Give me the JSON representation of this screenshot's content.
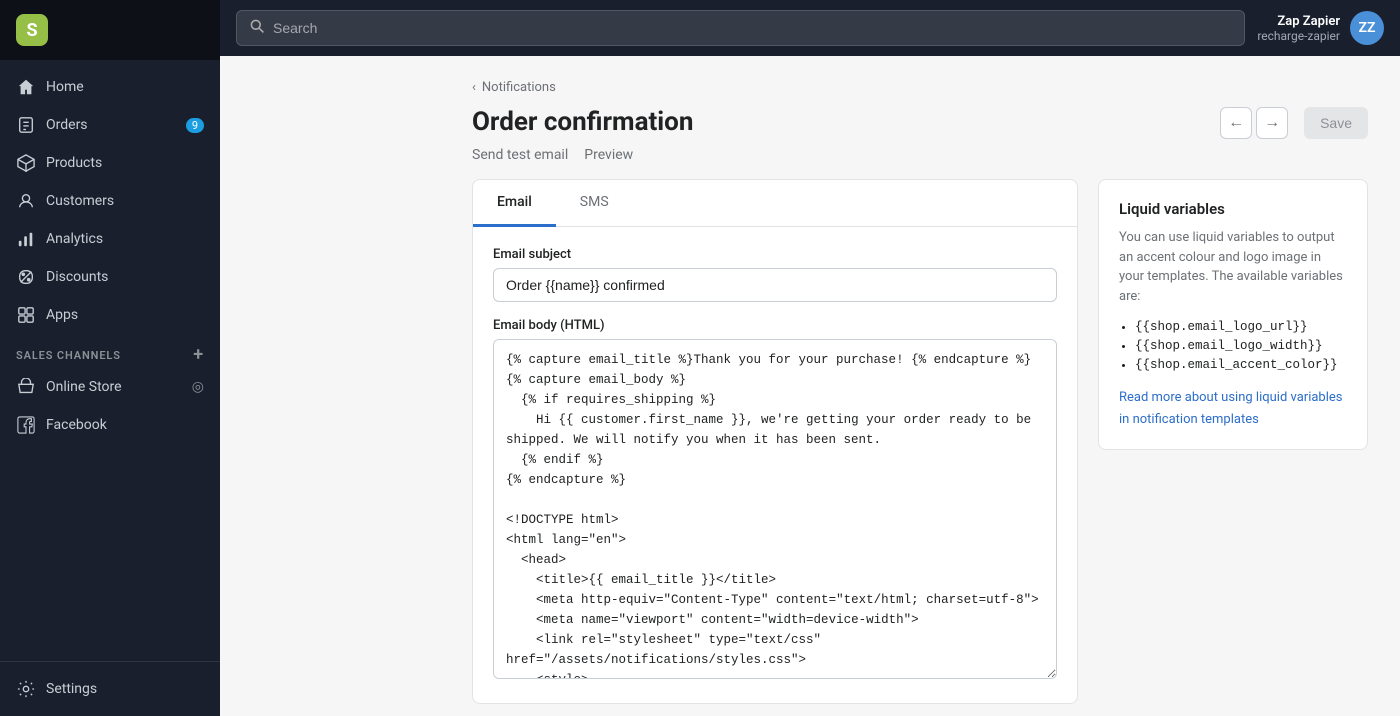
{
  "sidebar": {
    "logo_letter": "S",
    "store_name": "",
    "nav_items": [
      {
        "id": "home",
        "label": "Home",
        "icon": "home"
      },
      {
        "id": "orders",
        "label": "Orders",
        "icon": "orders",
        "badge": "9"
      },
      {
        "id": "products",
        "label": "Products",
        "icon": "products"
      },
      {
        "id": "customers",
        "label": "Customers",
        "icon": "customers"
      },
      {
        "id": "analytics",
        "label": "Analytics",
        "icon": "analytics"
      },
      {
        "id": "discounts",
        "label": "Discounts",
        "icon": "discounts"
      },
      {
        "id": "apps",
        "label": "Apps",
        "icon": "apps"
      }
    ],
    "sales_channels_label": "SALES CHANNELS",
    "sales_channels": [
      {
        "id": "online-store",
        "label": "Online Store",
        "icon": "store"
      },
      {
        "id": "facebook",
        "label": "Facebook",
        "icon": "facebook"
      }
    ],
    "settings_label": "Settings"
  },
  "topbar": {
    "search_placeholder": "Search",
    "user_name": "Zap Zapier",
    "user_sub": "recharge-zapier",
    "user_initials": "ZZ"
  },
  "breadcrumb": {
    "parent_label": "Notifications",
    "separator": "‹"
  },
  "page": {
    "title": "Order confirmation",
    "send_test_email_label": "Send test email",
    "preview_label": "Preview",
    "save_label": "Save"
  },
  "tabs": [
    {
      "id": "email",
      "label": "Email",
      "active": true
    },
    {
      "id": "sms",
      "label": "SMS",
      "active": false
    }
  ],
  "email_form": {
    "subject_label": "Email subject",
    "subject_value": "Order {{name}} confirmed",
    "body_label": "Email body (HTML)",
    "body_value": "{% capture email_title %}Thank you for your purchase! {% endcapture %}\n{% capture email_body %}\n  {% if requires_shipping %}\n    Hi {{ customer.first_name }}, we're getting your order ready to be shipped. We will notify you when it has been sent.\n  {% endif %}\n{% endcapture %}\n\n<!DOCTYPE html>\n<html lang=\"en\">\n  <head>\n    <title>{{ email_title }}</title>\n    <meta http-equiv=\"Content-Type\" content=\"text/html; charset=utf-8\">\n    <meta name=\"viewport\" content=\"width=device-width\">\n    <link rel=\"stylesheet\" type=\"text/css\" href=\"/assets/notifications/styles.css\">\n    <style>"
  },
  "liquid_variables": {
    "title": "Liquid variables",
    "description": "You can use liquid variables to output an accent colour and logo image in your templates. The available variables are:",
    "vars": [
      "{{shop.email_logo_url}}",
      "{{shop.email_logo_width}}",
      "{{shop.email_accent_color}}"
    ],
    "link_text": "Read more about using liquid variables in notification templates"
  }
}
